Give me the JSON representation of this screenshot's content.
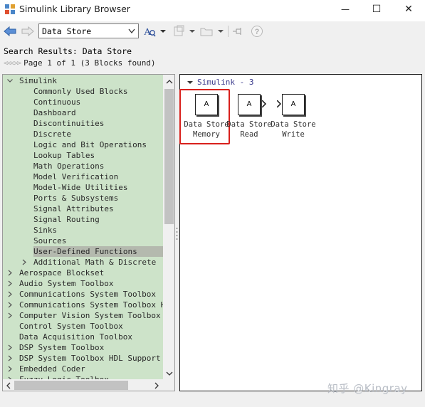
{
  "window": {
    "title": "Simulink Library Browser",
    "minimize_glyph": "—",
    "maximize_glyph": "☐",
    "close_glyph": "✕"
  },
  "toolbar": {
    "back_icon": "back-arrow-icon",
    "forward_icon": "forward-arrow-icon",
    "search_value": "Data Store",
    "search_options_icon": "search-options-icon",
    "new_model_icon": "new-model-icon",
    "open_folder_icon": "folder-icon",
    "pin_icon": "pin-icon",
    "help_icon": "help-icon"
  },
  "search": {
    "results_label": "Search Results: Data Store",
    "pager_nav": "<<<>>",
    "pager_text": "Page 1 of 1 (3 Blocks found)"
  },
  "tree": {
    "items": [
      {
        "label": "Simulink",
        "level": 0,
        "expander": "expanded"
      },
      {
        "label": "Commonly Used Blocks",
        "level": 1,
        "expander": "none"
      },
      {
        "label": "Continuous",
        "level": 1,
        "expander": "none"
      },
      {
        "label": "Dashboard",
        "level": 1,
        "expander": "none"
      },
      {
        "label": "Discontinuities",
        "level": 1,
        "expander": "none"
      },
      {
        "label": "Discrete",
        "level": 1,
        "expander": "none"
      },
      {
        "label": "Logic and Bit Operations",
        "level": 1,
        "expander": "none"
      },
      {
        "label": "Lookup Tables",
        "level": 1,
        "expander": "none"
      },
      {
        "label": "Math Operations",
        "level": 1,
        "expander": "none"
      },
      {
        "label": "Model Verification",
        "level": 1,
        "expander": "none"
      },
      {
        "label": "Model-Wide Utilities",
        "level": 1,
        "expander": "none"
      },
      {
        "label": "Ports & Subsystems",
        "level": 1,
        "expander": "none"
      },
      {
        "label": "Signal Attributes",
        "level": 1,
        "expander": "none"
      },
      {
        "label": "Signal Routing",
        "level": 1,
        "expander": "none"
      },
      {
        "label": "Sinks",
        "level": 1,
        "expander": "none"
      },
      {
        "label": "Sources",
        "level": 1,
        "expander": "none"
      },
      {
        "label": "User-Defined Functions",
        "level": 1,
        "expander": "none",
        "selected": true
      },
      {
        "label": "Additional Math & Discrete",
        "level": 1,
        "expander": "collapsed"
      },
      {
        "label": "Aerospace Blockset",
        "level": 0,
        "expander": "collapsed"
      },
      {
        "label": "Audio System Toolbox",
        "level": 0,
        "expander": "collapsed"
      },
      {
        "label": "Communications System Toolbox",
        "level": 0,
        "expander": "collapsed"
      },
      {
        "label": "Communications System Toolbox HDL",
        "level": 0,
        "expander": "collapsed"
      },
      {
        "label": "Computer Vision System Toolbox",
        "level": 0,
        "expander": "collapsed"
      },
      {
        "label": "Control System Toolbox",
        "level": 0,
        "expander": "none"
      },
      {
        "label": "Data Acquisition Toolbox",
        "level": 0,
        "expander": "none"
      },
      {
        "label": "DSP System Toolbox",
        "level": 0,
        "expander": "collapsed"
      },
      {
        "label": "DSP System Toolbox HDL Support",
        "level": 0,
        "expander": "collapsed"
      },
      {
        "label": "Embedded Coder",
        "level": 0,
        "expander": "collapsed"
      },
      {
        "label": "Fuzzy Logic Toolbox",
        "level": 0,
        "expander": "collapsed"
      }
    ]
  },
  "results": {
    "group_label": "Simulink - 3",
    "blocks": [
      {
        "icon_text": "A",
        "name_line1": "Data Store",
        "name_line2": "Memory",
        "highlighted": true,
        "ports": "none"
      },
      {
        "icon_text": "A",
        "name_line1": "Data Store",
        "name_line2": "Read",
        "highlighted": false,
        "ports": "out"
      },
      {
        "icon_text": "A",
        "name_line1": "Data Store",
        "name_line2": "Write",
        "highlighted": false,
        "ports": "in"
      }
    ]
  },
  "watermark": "知乎 @Kingray",
  "colors": {
    "tree_background": "#cde3c9",
    "tree_selected": "#b4b9ae",
    "highlight_border": "#d9201c"
  }
}
